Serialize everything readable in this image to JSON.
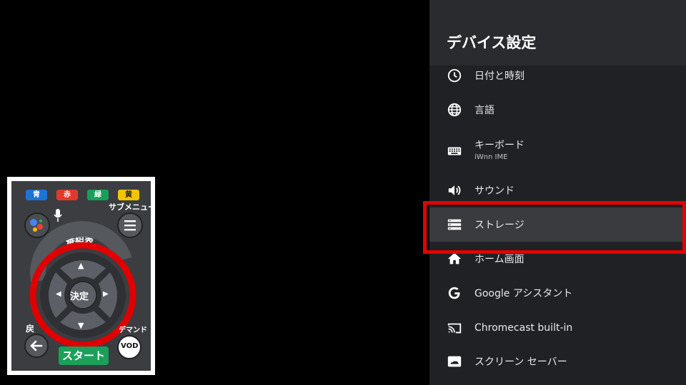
{
  "settings": {
    "title": "デバイス設定",
    "items": [
      {
        "label": "日付と時刻",
        "icon": "clock-icon"
      },
      {
        "label": "言語",
        "icon": "globe-icon"
      },
      {
        "label": "キーボード",
        "sub": "iWnn IME",
        "icon": "keyboard-icon"
      },
      {
        "label": "サウンド",
        "icon": "speaker-icon"
      },
      {
        "label": "ストレージ",
        "icon": "storage-icon",
        "focused": true
      },
      {
        "label": "ホーム画面",
        "icon": "home-icon"
      },
      {
        "label": "Google アシスタント",
        "icon": "google-g-icon"
      },
      {
        "label": "Chromecast built-in",
        "icon": "cast-icon"
      },
      {
        "label": "スクリーン セーバー",
        "icon": "screensaver-icon"
      }
    ]
  },
  "colors": {
    "panel_bg": "#202124",
    "header_bg": "#2a2b2e",
    "focus_bg": "#3a3b3e",
    "highlight_border": "#e60000",
    "blue_key": "#1e73d6",
    "red_key": "#e0392b",
    "green_key": "#16a05a",
    "yellow_key": "#f2c400"
  },
  "remote": {
    "color_keys": [
      "青",
      "赤",
      "緑",
      "黄"
    ],
    "sub_menu_label": "サブメニュー",
    "program_guide_label": "番組表",
    "ok_label": "決定",
    "back_label": "戻",
    "on_demand_label": "デマンド",
    "vod_label": "VOD",
    "start_label": "スタート",
    "up_arrow": "▲",
    "down_arrow": "▼",
    "left_arrow": "◀",
    "right_arrow": "▶"
  }
}
